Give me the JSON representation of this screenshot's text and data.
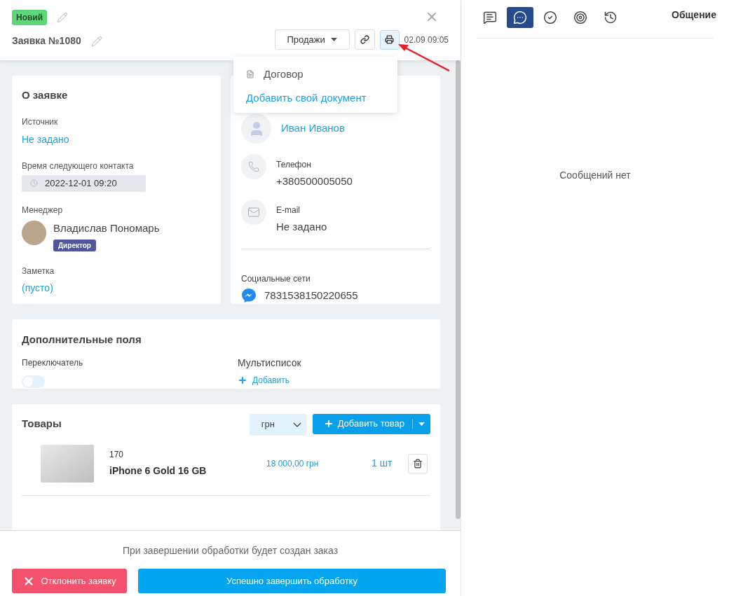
{
  "header": {
    "status_badge": "Новий",
    "title": "Заявка №1080",
    "pipeline_dropdown": "Продажи",
    "date": "02.09 09:05"
  },
  "print_menu": {
    "items": [
      {
        "kind": "document",
        "label": "Договор"
      },
      {
        "kind": "link",
        "label": "Добавить свой документ"
      }
    ]
  },
  "about": {
    "title": "О заявке",
    "source_label": "Источник",
    "source_value": "Не задано",
    "next_contact_label": "Время следующего контакта",
    "next_contact_value": "2022-12-01 09:20",
    "manager_label": "Менеджер",
    "manager_name": "Владислав Пономарь",
    "manager_role": "Директор",
    "note_label": "Заметка",
    "note_value": "(пусто)"
  },
  "contact": {
    "name": "Иван Иванов",
    "phone_label": "Телефон",
    "phone": "+380500005050",
    "email_label": "E-mail",
    "email": "Не задано",
    "social_label": "Социальные сети",
    "social_id": "7831538150220655"
  },
  "extra_fields": {
    "title": "Дополнительные поля",
    "fields": [
      {
        "kind": "switch",
        "label": "Переключатель",
        "on": false
      },
      {
        "kind": "multilist",
        "label": "Мультисписок",
        "add_label": "Добавить"
      }
    ]
  },
  "products": {
    "title": "Товары",
    "currency": "грн",
    "add_button": "Добавить товар",
    "items": [
      {
        "code": "170",
        "name": "iPhone 6 Gold 16 GB",
        "price": "18 000,00 грн",
        "quantity": "1 шт"
      }
    ]
  },
  "footer": {
    "note": "При завершении обработки будет создан заказ",
    "reject_button": "Отклонить заявку",
    "complete_button": "Успешно завершить обработку"
  },
  "side_panel": {
    "tabs": [
      {
        "kind": "comment",
        "selected": false
      },
      {
        "kind": "chat",
        "selected": true
      },
      {
        "kind": "task",
        "selected": false
      },
      {
        "kind": "goal",
        "selected": false
      },
      {
        "kind": "history",
        "selected": false
      }
    ],
    "title": "Общение",
    "empty_text": "Сообщений нет"
  }
}
